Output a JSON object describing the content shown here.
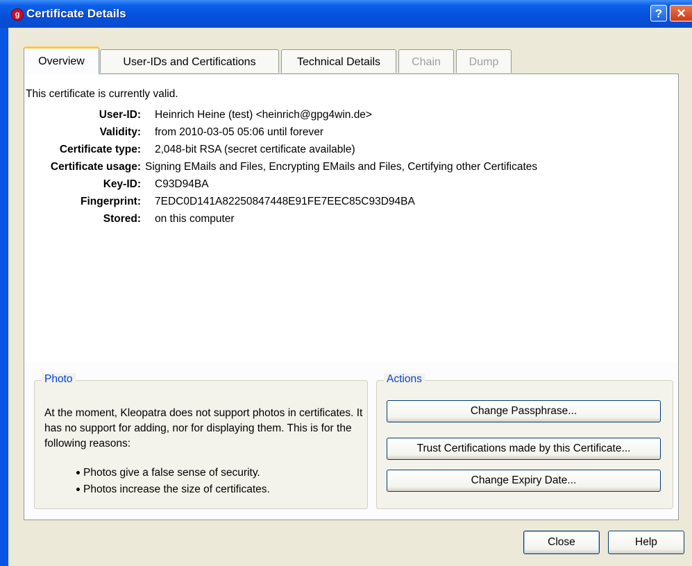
{
  "window": {
    "title": "Certificate Details",
    "help_glyph": "?",
    "close_glyph": "✕",
    "icon": "kleopatra-app-icon"
  },
  "tabs": [
    {
      "label": "Overview",
      "state": "active"
    },
    {
      "label": "User-IDs and Certifications",
      "state": "normal"
    },
    {
      "label": "Technical Details",
      "state": "normal"
    },
    {
      "label": "Chain",
      "state": "disabled"
    },
    {
      "label": "Dump",
      "state": "disabled"
    }
  ],
  "overview": {
    "status": "This certificate is currently valid.",
    "fields": [
      {
        "label": "User-ID:",
        "value": "Heinrich Heine (test) <heinrich@gpg4win.de>"
      },
      {
        "label": "Validity:",
        "value": "from 2010-03-05 05:06 until forever"
      },
      {
        "label": "Certificate type:",
        "value": "2,048-bit RSA (secret certificate available)"
      },
      {
        "label": "Certificate usage:",
        "value": "Signing EMails and Files, Encrypting EMails and Files, Certifying other Certificates"
      },
      {
        "label": "Key-ID:",
        "value": "C93D94BA"
      },
      {
        "label": "Fingerprint:",
        "value": "7EDC0D141A82250847448E91FE7EEC85C93D94BA"
      },
      {
        "label": "Stored:",
        "value": "on this computer"
      }
    ]
  },
  "photo": {
    "title": "Photo",
    "text": "At the moment, Kleopatra does not support photos in certificates. It has no support for adding, nor for displaying them. This is for the following reasons:",
    "bullets": [
      "Photos give a false sense of security.",
      "Photos increase the size of certificates."
    ]
  },
  "actions": {
    "title": "Actions",
    "change_passphrase": "Change Passphrase...",
    "trust_certifications": "Trust Certifications made by this Certificate...",
    "change_expiry": "Change Expiry Date..."
  },
  "footer": {
    "close_label": "Close",
    "help_label": "Help"
  },
  "colors": {
    "titlebar": "#0550db",
    "dialog_bg": "#ece9d8",
    "group_title": "#0046d5",
    "active_tab_accent": "#ffc83c"
  }
}
